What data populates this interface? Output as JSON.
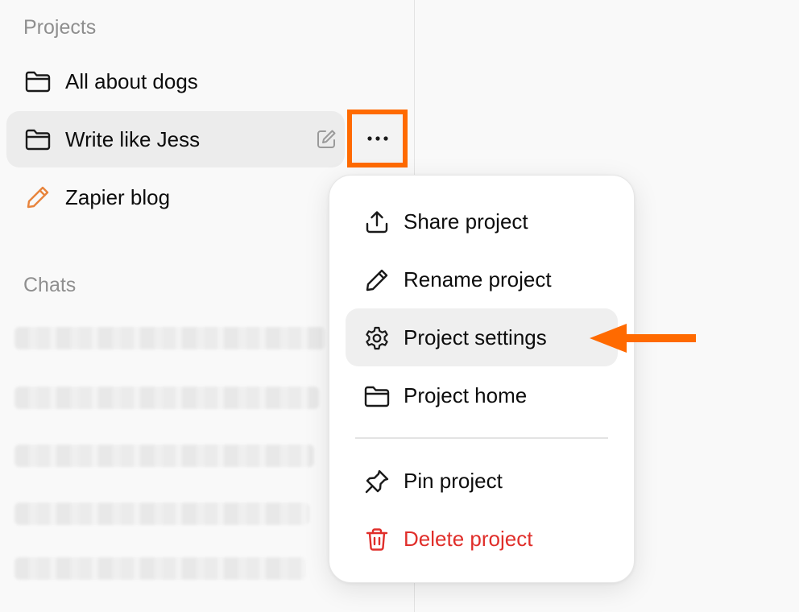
{
  "sidebar": {
    "projects_title": "Projects",
    "projects": [
      {
        "label": "All about dogs",
        "icon": "folder-icon"
      },
      {
        "label": "Write like Jess",
        "icon": "folder-icon",
        "active": true
      },
      {
        "label": "Zapier blog",
        "icon": "pencil-icon",
        "icon_color": "#e8843c"
      }
    ],
    "chats_title": "Chats"
  },
  "context_menu": {
    "items": [
      {
        "label": "Share project",
        "icon": "share-icon"
      },
      {
        "label": "Rename project",
        "icon": "pencil-icon"
      },
      {
        "label": "Project settings",
        "icon": "gear-icon",
        "highlighted": true
      },
      {
        "label": "Project home",
        "icon": "folder-icon"
      },
      {
        "label": "Pin project",
        "icon": "pin-icon"
      },
      {
        "label": "Delete project",
        "icon": "trash-icon",
        "color": "#e02e2a"
      }
    ]
  },
  "colors": {
    "annotation": "#ff6a00",
    "danger": "#e02e2a",
    "accent_pencil": "#e8843c"
  }
}
